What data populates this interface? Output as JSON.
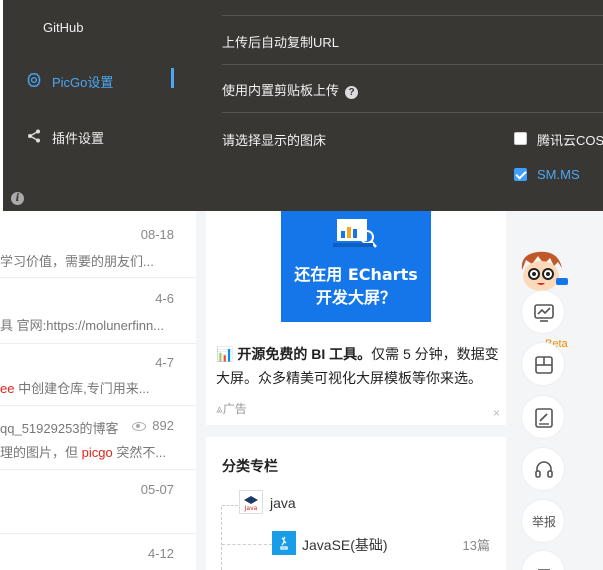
{
  "app": {
    "sidebar": {
      "items": [
        {
          "label": "GitHub",
          "icon": "github-icon"
        },
        {
          "label": "PicGo设置",
          "icon": "gear-icon",
          "active": true
        },
        {
          "label": "插件设置",
          "icon": "share-icon"
        }
      ],
      "info_icon": "i"
    },
    "settings": {
      "auto_copy_url": "上传后自动复制URL",
      "clipboard_upload": "使用内置剪贴板上传",
      "help_icon": "?",
      "choose_hosts": "请选择显示的图床",
      "hosts": [
        {
          "label": "腾讯云COS",
          "checked": false
        },
        {
          "label": "SM.MS",
          "checked": true
        }
      ]
    },
    "accent_color": "#4aa7f5",
    "panel_color": "#393733"
  },
  "blog": {
    "posts": [
      {
        "date": "08-18",
        "snippet": "学习价值，需要的朋友们..."
      },
      {
        "date": "4-6",
        "snippet": "具 官网:https://molunerfinn..."
      },
      {
        "date": "4-7",
        "snippet_hl": "ee",
        "snippet_rest": " 中创建仓库,专门用来..."
      },
      {
        "title": "qq_51929253的博客",
        "views": "892",
        "snippet_pre": "理的图片，但 ",
        "snippet_hl": "picgo",
        "snippet_post": " 突然不..."
      },
      {
        "date": "05-07"
      },
      {
        "date": "4-12"
      }
    ],
    "ad": {
      "line1": "还在用 ECharts",
      "line2": "开发大屏？",
      "text_icon": "📊",
      "text_bold": "开源免费的 BI 工具。",
      "text_rest": "仅需 5 分钟，数据变大屏。众多精美可视化大屏模板等你来选。",
      "label": "广告",
      "close": "×"
    },
    "column": {
      "title": "分类专栏",
      "parent": "java",
      "child": "JavaSE(基础)",
      "child_count": "13篇"
    },
    "tools": {
      "beta": "Beta",
      "report": "举报"
    }
  }
}
